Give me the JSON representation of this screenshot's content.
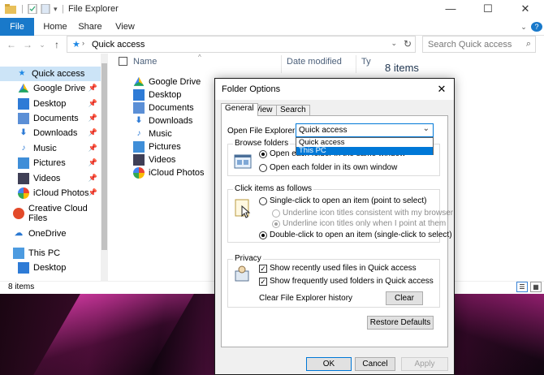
{
  "window": {
    "title": "File Explorer",
    "controls": {
      "minimize": "—",
      "maximize": "☐",
      "close": "✕"
    }
  },
  "ribbon": {
    "tabs": [
      "File",
      "Home",
      "Share",
      "View"
    ]
  },
  "address": {
    "path": "Quick access",
    "search_placeholder": "Search Quick access"
  },
  "navpane": {
    "items": [
      {
        "label": "Quick access",
        "icon": "star-icon",
        "selected": true
      },
      {
        "label": "Google Drive",
        "icon": "google-drive-icon",
        "pinned": true
      },
      {
        "label": "Desktop",
        "icon": "desktop-folder-icon",
        "pinned": true
      },
      {
        "label": "Documents",
        "icon": "documents-icon",
        "pinned": true
      },
      {
        "label": "Downloads",
        "icon": "downloads-icon",
        "pinned": true
      },
      {
        "label": "Music",
        "icon": "music-icon",
        "pinned": true
      },
      {
        "label": "Pictures",
        "icon": "pictures-icon",
        "pinned": true
      },
      {
        "label": "Videos",
        "icon": "videos-icon",
        "pinned": true
      },
      {
        "label": "iCloud Photos",
        "icon": "icloud-photos-icon",
        "pinned": true
      },
      {
        "label": "Creative Cloud Files",
        "icon": "creative-cloud-icon"
      },
      {
        "label": "OneDrive",
        "icon": "onedrive-icon"
      },
      {
        "label": "This PC",
        "icon": "this-pc-icon"
      },
      {
        "label": "Desktop",
        "icon": "desktop-folder-icon"
      }
    ]
  },
  "content": {
    "columns": [
      "Name",
      "Date modified",
      "Ty"
    ],
    "count_label": "8 items",
    "files": [
      "Google Drive",
      "Desktop",
      "Documents",
      "Downloads",
      "Music",
      "Pictures",
      "Videos",
      "iCloud Photos"
    ]
  },
  "status": {
    "items": "8 items"
  },
  "dialog": {
    "title": "Folder Options",
    "tabs": [
      "General",
      "View",
      "Search"
    ],
    "open_label": "Open File Explorer to:",
    "open_value": "Quick access",
    "dropdown_options": [
      "Quick access",
      "This PC"
    ],
    "browse": {
      "label": "Browse folders",
      "same_window": "Open each folder in the same window",
      "own_window": "Open each folder in its own window"
    },
    "click": {
      "label": "Click items as follows",
      "single": "Single-click to open an item (point to select)",
      "underline_browser": "Underline icon titles consistent with my browser",
      "underline_point": "Underline icon titles only when I point at them",
      "double": "Double-click to open an item (single-click to select)"
    },
    "privacy": {
      "label": "Privacy",
      "recent_files": "Show recently used files in Quick access",
      "frequent_folders": "Show frequently used folders in Quick access",
      "clear_history": "Clear File Explorer history",
      "clear_button": "Clear"
    },
    "restore_button": "Restore Defaults",
    "ok": "OK",
    "cancel": "Cancel",
    "apply": "Apply"
  }
}
